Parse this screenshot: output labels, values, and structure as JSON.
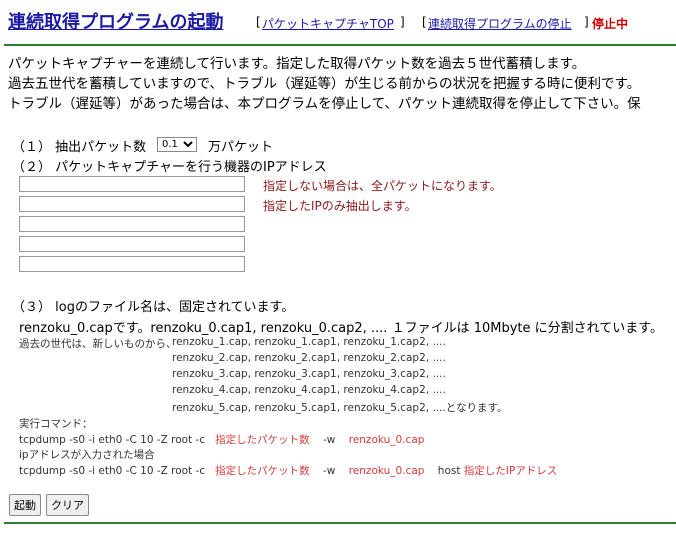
{
  "header": {
    "title": "連続取得プログラムの起動",
    "link_capture_top": "パケットキャプチャTOP",
    "link_stop_program": "連続取得プログラムの停止",
    "bracket_open": "[",
    "bracket_close": "]",
    "status": "停止中"
  },
  "intro": [
    "パケットキャプチャーを連続して行います。指定した取得パケット数を過去５世代蓄積します。",
    "過去五世代を蓄積していますので、トラブル（遅延等）が生じる前からの状況を把握する時に便利です。",
    "トラブル（遅延等）があった場合は、本プログラムを停止して、パケット連続取得を停止して下さい。保"
  ],
  "section1": {
    "label": "（１） 抽出パケット数",
    "selected": "0.1",
    "unit": "万パケット"
  },
  "section2": {
    "label": "（２） パケットキャプチャーを行う機器のIPアドレス",
    "fields": [
      "",
      "",
      "",
      "",
      ""
    ],
    "note1": "指定しない場合は、全パケットになります。",
    "note2": "指定したIPのみ抽出します。"
  },
  "section3": {
    "label": "（３） logのファイル名は、固定されています。",
    "line1": "renzoku_0.capです。renzoku_0.cap1, renzoku_0.cap2, .... １ファイルは 10Mbyte に分割されています。",
    "gen_intro": "過去の世代は、新しいものから、",
    "generations": [
      "renzoku_1.cap, renzoku_1.cap1, renzoku_1.cap2, ....",
      "renzoku_2.cap, renzoku_2.cap1, renzoku_2.cap2, ....",
      "renzoku_3.cap, renzoku_3.cap1, renzoku_3.cap2, ....",
      "renzoku_4.cap, renzoku_4.cap1, renzoku_4.cap2, ....",
      "renzoku_5.cap, renzoku_5.cap1, renzoku_5.cap2, ....となります。"
    ],
    "exec_label": "実行コマンド：",
    "cmd1_prefix": "tcpdump -s0 -i eth0 -C 10 -Z root -c",
    "cmd_packet_count": "指定したパケット数",
    "cmd_w": "-w",
    "cmd_file": "renzoku_0.cap",
    "ip_entered": "ipアドレスが入力された場合",
    "cmd2_prefix": "tcpdump -s0 -i eth0 -C 10 -Z root -c",
    "cmd2_host": "host",
    "cmd2_ip": "指定したIPアドレス"
  },
  "buttons": {
    "start": "起動",
    "clear": "クリア"
  }
}
